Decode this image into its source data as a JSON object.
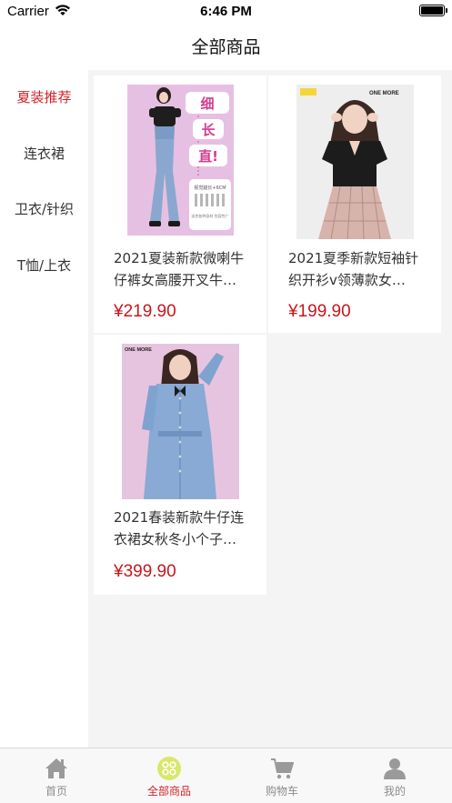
{
  "status_bar": {
    "carrier": "Carrier",
    "time": "6:46 PM"
  },
  "nav": {
    "title": "全部商品"
  },
  "sidebar": {
    "items": [
      {
        "label": "夏装推荐",
        "active": true
      },
      {
        "label": "连衣裙",
        "active": false
      },
      {
        "label": "卫衣/针织",
        "active": false
      },
      {
        "label": "T恤/上衣",
        "active": false
      }
    ]
  },
  "products": [
    {
      "title_line1": "2021夏装新款微喇牛",
      "title_line2": "仔裤女高腰开叉牛…",
      "price": "¥219.90",
      "image": {
        "tag1": "细",
        "tag2": "长",
        "tag3": "直!",
        "caption": "视觉腿长+6CM",
        "footnote": "适合各种身材 包容性广"
      }
    },
    {
      "title_line1": "2021夏季新款短袖针",
      "title_line2": "织开衫v领薄款女…",
      "price": "¥199.90",
      "image": {
        "brand": "ONE MORE"
      }
    },
    {
      "title_line1": "2021春装新款牛仔连",
      "title_line2": "衣裙女秋冬小个子…",
      "price": "¥399.90",
      "image": {
        "brand": "ONE MORE"
      }
    }
  ],
  "tabbar": {
    "tabs": [
      {
        "label": "首页",
        "icon": "home-icon",
        "active": false
      },
      {
        "label": "全部商品",
        "icon": "grid-icon",
        "active": true
      },
      {
        "label": "购物车",
        "icon": "cart-icon",
        "active": false
      },
      {
        "label": "我的",
        "icon": "user-icon",
        "active": false
      }
    ]
  },
  "colors": {
    "accent": "#d0232a",
    "price": "#c8161d",
    "inactive_tab": "#8c8c8c"
  }
}
